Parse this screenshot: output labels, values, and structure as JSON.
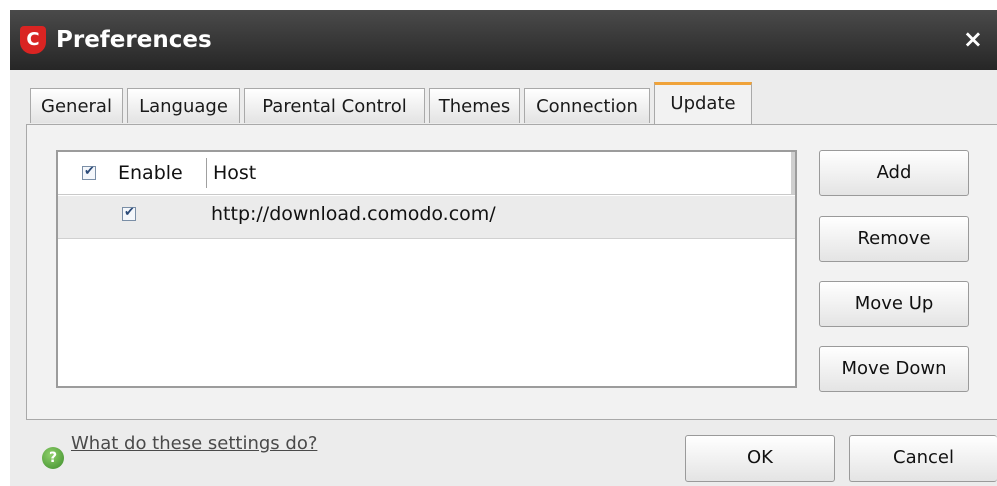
{
  "window": {
    "title": "Preferences",
    "close_symbol": "×",
    "app_icon_letter": "C"
  },
  "tabs": [
    {
      "label": "General",
      "active": false
    },
    {
      "label": "Language",
      "active": false
    },
    {
      "label": "Parental Control",
      "active": false
    },
    {
      "label": "Themes",
      "active": false
    },
    {
      "label": "Connection",
      "active": false
    },
    {
      "label": "Update",
      "active": true
    }
  ],
  "host_list": {
    "columns": [
      "Enable",
      "Host"
    ],
    "header_checkbox_checked": true,
    "rows": [
      {
        "enabled": true,
        "host": "http://download.comodo.com/"
      }
    ]
  },
  "side_buttons": {
    "add": "Add",
    "remove": "Remove",
    "move_up": "Move Up",
    "move_down": "Move Down"
  },
  "footer": {
    "help_link": "What do these settings do?",
    "ok": "OK",
    "cancel": "Cancel"
  },
  "icons": {
    "app": "comodo-logo-icon",
    "close": "close-icon",
    "help": "help-question-icon",
    "checkbox_check": "✔"
  },
  "colors": {
    "titlebar": "#333333",
    "active_tab_accent": "#f0a33a",
    "app_icon": "#d92422",
    "help_icon": "#4a9a34"
  }
}
